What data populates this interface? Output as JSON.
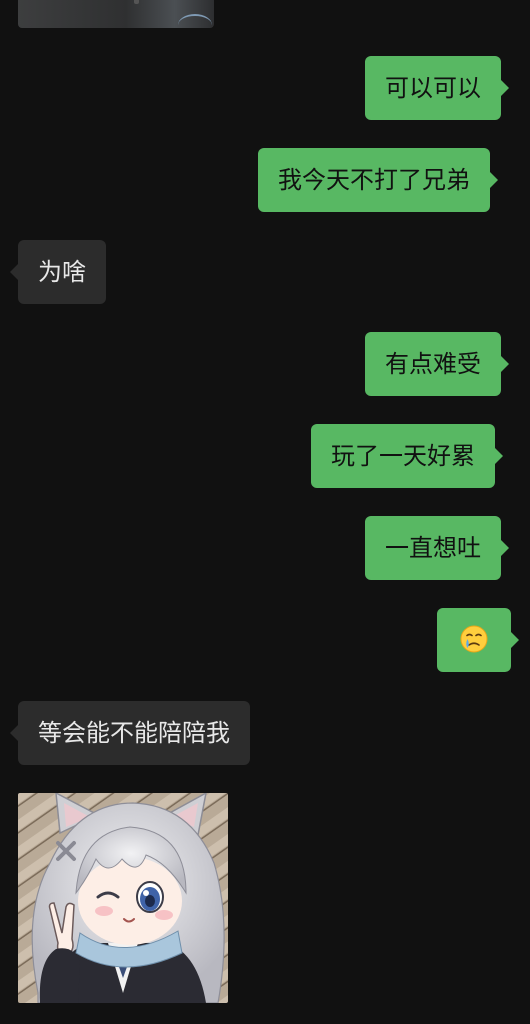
{
  "conversation": {
    "messages": [
      {
        "side": "out",
        "text": "可以可以"
      },
      {
        "side": "out",
        "text": "我今天不打了兄弟"
      },
      {
        "side": "in",
        "text": "为啥"
      },
      {
        "side": "out",
        "text": "有点难受"
      },
      {
        "side": "out",
        "text": "玩了一天好累"
      },
      {
        "side": "out",
        "text": "一直想吐"
      },
      {
        "side": "out",
        "emoji": "face-holding-back-tears"
      },
      {
        "side": "in",
        "text": "等会能不能陪陪我"
      }
    ],
    "sticker": {
      "icon": "anime-cat-girl-wink-peace-sticker"
    }
  },
  "colors": {
    "background": "#111111",
    "outgoing_bubble": "#58b863",
    "incoming_bubble": "#2c2c2c",
    "outgoing_text": "#111111",
    "incoming_text": "#e8e8e8"
  }
}
